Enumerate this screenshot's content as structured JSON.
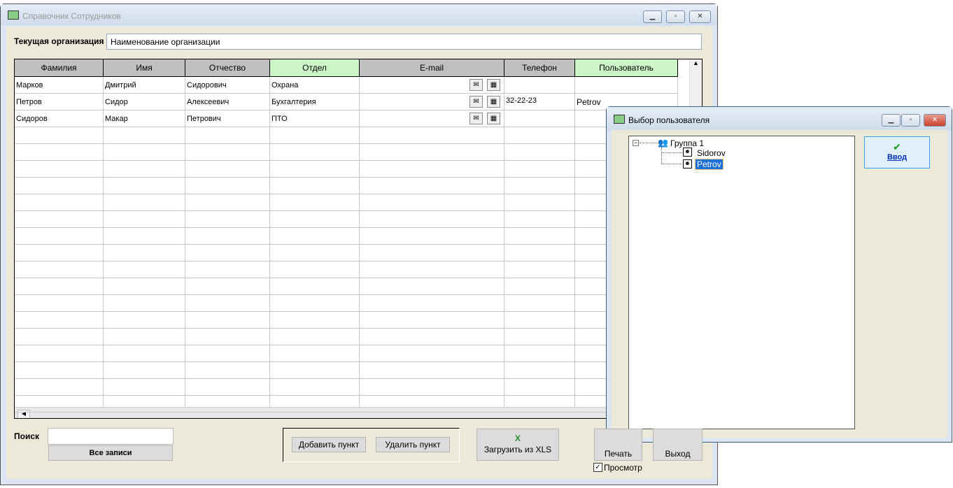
{
  "main_window": {
    "title": "Справочник Сотрудников",
    "org_label": "Текущая организация",
    "org_value": "Наименование организации"
  },
  "table": {
    "columns": [
      "Фамилия",
      "Имя",
      "Отчество",
      "Отдел",
      "E-mail",
      "Телефон",
      "Пользователь"
    ],
    "rows": [
      {
        "last": "Марков",
        "first": "Дмитрий",
        "middle": "Сидорович",
        "dept": "Охрана",
        "email": "",
        "phone": "",
        "user": ""
      },
      {
        "last": "Петров",
        "first": "Сидор",
        "middle": "Алексеевич",
        "dept": "Бухгалтерия",
        "email": "",
        "phone": "32-22-23",
        "user": "Petrov"
      },
      {
        "last": "Сидоров",
        "first": "Макар",
        "middle": "Петрович",
        "dept": "ПТО",
        "email": "",
        "phone": "",
        "user": ""
      }
    ]
  },
  "bottom": {
    "search_label": "Поиск",
    "search_value": "",
    "all_records": "Все записи",
    "add": "Добавить пункт",
    "delete": "Удалить пункт",
    "load_xls": "Загрузить из XLS",
    "print": "Печать",
    "exit": "Выход",
    "preview": "Просмотр",
    "preview_checked": true
  },
  "dialog": {
    "title": "Выбор пользователя",
    "group": "Группа 1",
    "users": [
      "Sidorov",
      "Petrov"
    ],
    "selected": "Petrov",
    "ok": "Ввод"
  }
}
